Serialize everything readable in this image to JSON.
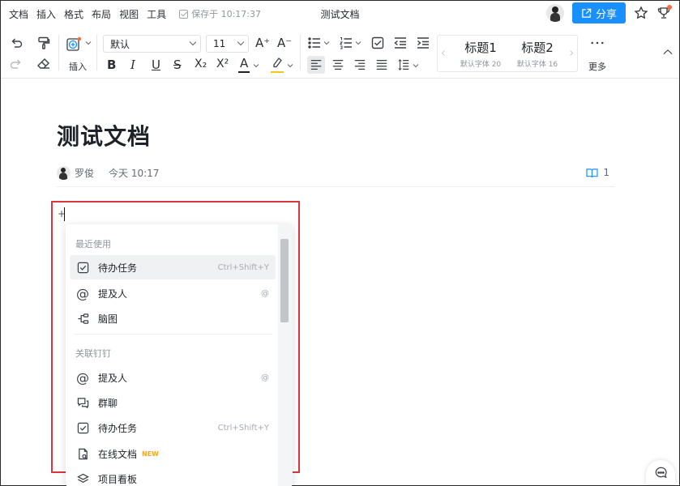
{
  "menubar": {
    "items": [
      "文档",
      "插入",
      "格式",
      "布局",
      "视图",
      "工具"
    ],
    "saved_text": "保存于 10:17:37"
  },
  "window": {
    "title": "测试文档"
  },
  "header": {
    "share_label": "分享"
  },
  "toolbar": {
    "insert_label": "插入",
    "font_family": "默认",
    "font_size": "11",
    "styles": [
      {
        "name": "标题1",
        "sub": "默认字体 20"
      },
      {
        "name": "标题2",
        "sub": "默认字体 16"
      }
    ],
    "more_label": "更多",
    "bold": "B",
    "italic": "I",
    "underline": "U",
    "strike": "S",
    "subscript": "X₂",
    "superscript": "X²",
    "font_color": "A",
    "grow_font": "A⁺",
    "shrink_font": "A⁻"
  },
  "document": {
    "title": "测试文档",
    "author": "罗俊",
    "time": "今天 10:17",
    "read_count": "1",
    "line_prefix": "+"
  },
  "popup": {
    "recent_title": "最近使用",
    "recent": [
      {
        "icon": "checkbox-icon",
        "label": "待办任务",
        "shortcut": "Ctrl+Shift+Y"
      },
      {
        "icon": "at-icon",
        "label": "提及人",
        "shortcut": "@"
      },
      {
        "icon": "mindmap-icon",
        "label": "脑图",
        "shortcut": ""
      }
    ],
    "dingding_title": "关联钉钉",
    "dingding": [
      {
        "icon": "at-icon",
        "label": "提及人",
        "shortcut": "@"
      },
      {
        "icon": "group-chat-icon",
        "label": "群聊",
        "shortcut": ""
      },
      {
        "icon": "checkbox-icon",
        "label": "待办任务",
        "shortcut": "Ctrl+Shift+Y"
      },
      {
        "icon": "online-doc-icon",
        "label": "在线文档",
        "shortcut": "",
        "badge": "NEW"
      },
      {
        "icon": "kanban-icon",
        "label": "项目看板",
        "shortcut": ""
      }
    ]
  },
  "colors": {
    "accent": "#1890ff",
    "highlight_box": "#d9363e",
    "font_color_bar": "#1f2329",
    "highlight_bar": "#f5c518"
  }
}
